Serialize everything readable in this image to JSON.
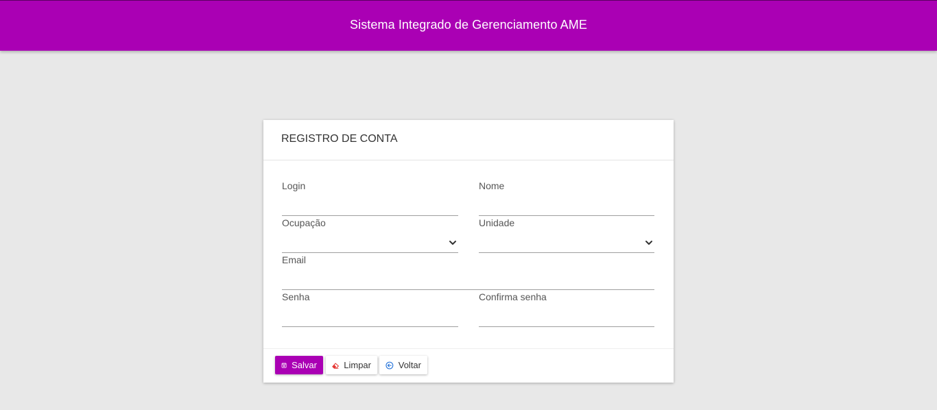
{
  "header": {
    "title": "Sistema Integrado de Gerenciamento AME"
  },
  "form": {
    "title": "REGISTRO DE CONTA",
    "fields": {
      "login": {
        "label": "Login",
        "value": ""
      },
      "nome": {
        "label": "Nome",
        "value": ""
      },
      "ocupacao": {
        "label": "Ocupação",
        "value": ""
      },
      "unidade": {
        "label": "Unidade",
        "value": ""
      },
      "email": {
        "label": "Email",
        "value": ""
      },
      "senha": {
        "label": "Senha",
        "value": ""
      },
      "confirma_senha": {
        "label": "Confirma senha",
        "value": ""
      }
    },
    "buttons": {
      "save": "Salvar",
      "clear": "Limpar",
      "back": "Voltar"
    }
  },
  "colors": {
    "brand": "#aa00b4",
    "background": "#e8e8e8",
    "clear_icon": "#e53935",
    "back_icon": "#1e6fd9"
  },
  "icons": {
    "save": "floppy-disk-icon",
    "clear": "eraser-icon",
    "back": "arrow-circle-left-icon",
    "select": "chevron-down-icon"
  }
}
